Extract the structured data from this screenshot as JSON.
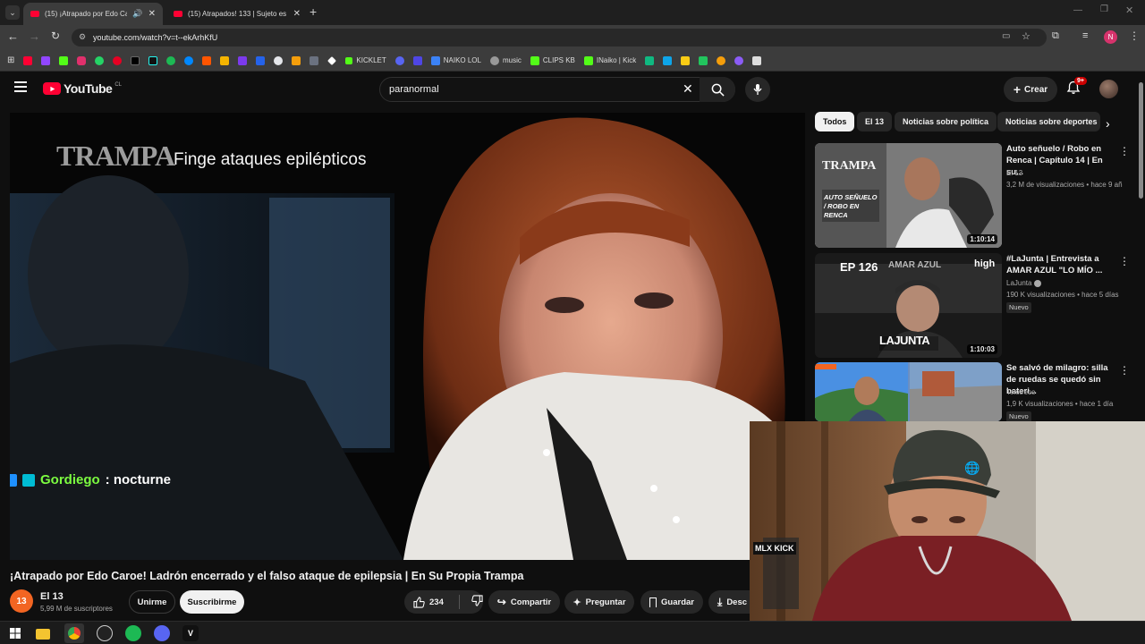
{
  "browser": {
    "tabs": [
      {
        "title": "(15) ¡Atrapado por Edo Caroe!"
      },
      {
        "title": "(15) Atrapados! 133 | Sujeto es"
      }
    ],
    "url": "youtube.com/watch?v=t--ekArhKfU",
    "bookmarks": [
      {
        "label": "KICKLET",
        "color": "#53fc18"
      },
      {
        "label": "NAIKO LOL",
        "color": "#3b82f6"
      },
      {
        "label": "music",
        "color": "#999999"
      },
      {
        "label": "CLIPS KB",
        "color": "#53fc18"
      },
      {
        "label": "INaiko | Kick",
        "color": "#53fc18"
      }
    ],
    "profile_initial": "N"
  },
  "youtube": {
    "logo_text": "YouTube",
    "region": "CL",
    "search_value": "paranormal",
    "create_label": "Crear",
    "notifications_badge": "9+"
  },
  "video": {
    "overlay_logo": "TRAMPA",
    "overlay_caption": "Finge ataques epilépticos",
    "chat_user": "Gordiego",
    "chat_message": ": nocturne",
    "title": "¡Atrapado por Edo Caroe! Ladrón encerrado y el falso ataque de epilepsia | En Su Propia Trampa",
    "channel_name": "El 13",
    "channel_avatar_text": "13",
    "subscribers": "5,99 M de suscriptores",
    "join_label": "Unirme",
    "subscribe_label": "Suscribirme",
    "likes": "234",
    "share_label": "Compartir",
    "ask_label": "Preguntar",
    "save_label": "Guardar",
    "download_label": "Desc"
  },
  "chips": [
    "Todos",
    "El 13",
    "Noticias sobre política",
    "Noticias sobre deportes"
  ],
  "recommendations": [
    {
      "title": "Auto señuelo / Robo en Renca | Capítulo 14 | En su...",
      "channel": "El 13",
      "stats": "3,2 M de visualizaciones • hace 9 añ",
      "duration": "1:10:14",
      "thumb_overlay": "AUTO SEÑUELO / ROBO EN RENCA",
      "thumb_logo": "TRAMPA"
    },
    {
      "title": "#LaJunta | Entrevista a AMAR AZUL \"LO MÍO ...",
      "channel": "LaJunta",
      "stats": "190 K visualizaciones • hace 5 días",
      "badge": "Nuevo",
      "duration": "1:10:03",
      "thumb_ep": "EP 126",
      "thumb_brand": "high",
      "thumb_logo": "LAJUNTA",
      "thumb_band": "AMAR AZUL"
    },
    {
      "title": "Se salvó de milagro: silla de ruedas se quedó sin bateri...",
      "channel": "Teletrece",
      "stats": "1,9 K visualizaciones • hace 1 día",
      "badge": "Nuevo"
    }
  ],
  "webcam": {
    "cap_logo": "🌐",
    "shelf_text": "MLX KICK"
  }
}
